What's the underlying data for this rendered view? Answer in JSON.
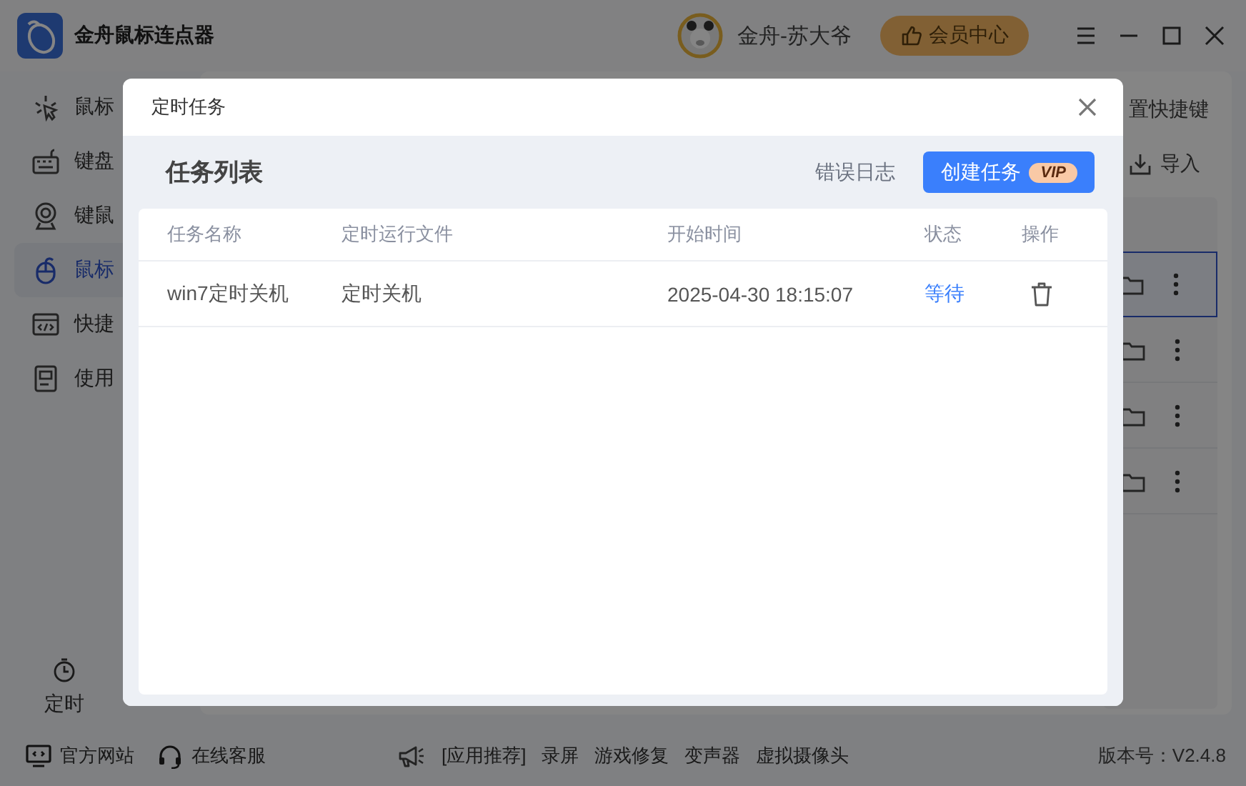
{
  "app": {
    "title": "金舟鼠标连点器"
  },
  "user": {
    "name": "金舟-苏大爷"
  },
  "vip_center": {
    "label": "会员中心"
  },
  "sidebar": {
    "items": [
      {
        "label": "鼠标",
        "selected": false
      },
      {
        "label": "键盘",
        "selected": false
      },
      {
        "label": "键鼠",
        "selected": false
      },
      {
        "label": "鼠标",
        "selected": true
      },
      {
        "label": "快捷",
        "selected": false
      },
      {
        "label": "使用",
        "selected": false
      }
    ],
    "bottom": {
      "label": "定时"
    }
  },
  "toolbar": {
    "shortcut": "置快捷键",
    "import": "导入"
  },
  "list_rows": [
    {
      "selected": true
    },
    {
      "selected": false
    },
    {
      "selected": false
    },
    {
      "selected": false
    }
  ],
  "footer": {
    "links": [
      "官方网站",
      "在线客服"
    ],
    "promo_label": "[应用推荐]",
    "promo_links": [
      "录屏",
      "游戏修复",
      "变声器",
      "虚拟摄像头"
    ],
    "version": "版本号：V2.4.8"
  },
  "dialog": {
    "title": "定时任务",
    "heading": "任务列表",
    "error_log": "错误日志",
    "create_button": {
      "label": "创建任务",
      "badge": "VIP"
    },
    "table": {
      "columns": [
        "任务名称",
        "定时运行文件",
        "开始时间",
        "状态",
        "操作"
      ],
      "rows": [
        {
          "name": "win7定时关机",
          "file": "定时关机",
          "start": "2025-04-30 18:15:07",
          "status": "等待"
        }
      ]
    }
  }
}
